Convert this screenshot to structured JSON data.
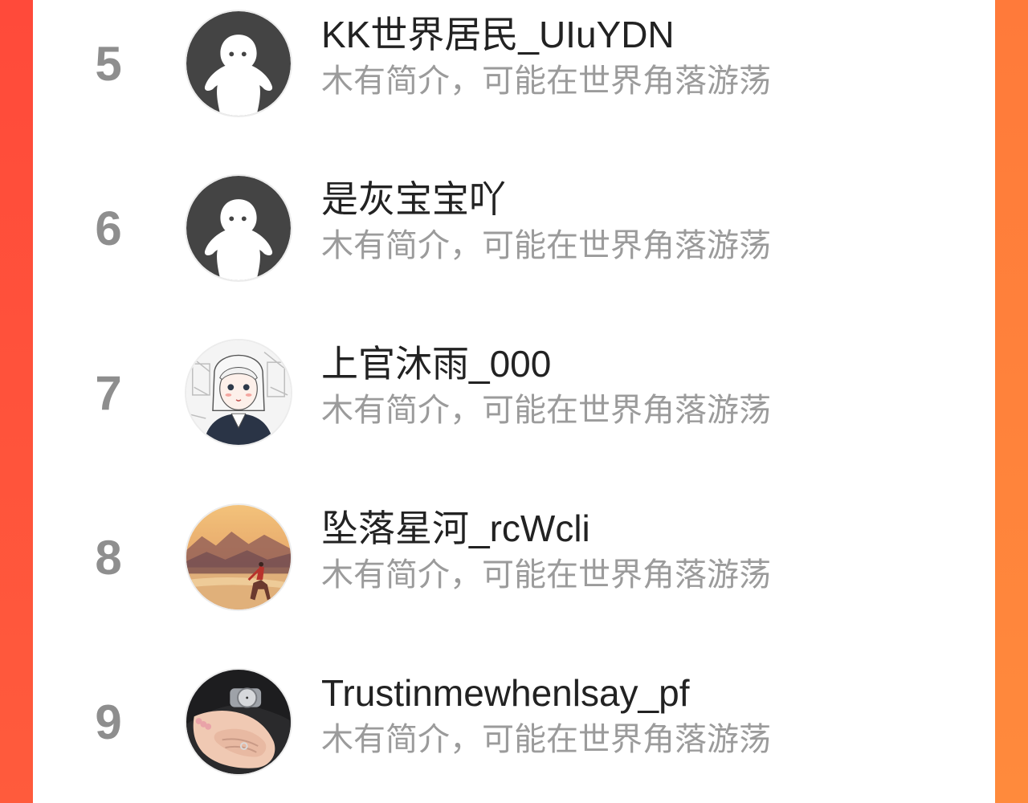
{
  "ranking": {
    "items": [
      {
        "rank": "5",
        "name": "KK世界居民_UIuYDN",
        "desc": "木有简介，可能在世界角落游荡",
        "avatar": "default-avatar-icon"
      },
      {
        "rank": "6",
        "name": "是灰宝宝吖",
        "desc": "木有简介，可能在世界角落游荡",
        "avatar": "default-avatar-icon"
      },
      {
        "rank": "7",
        "name": "上官沐雨_000",
        "desc": "木有简介，可能在世界角落游荡",
        "avatar": "anime-girl-avatar"
      },
      {
        "rank": "8",
        "name": "坠落星河_rcWcli",
        "desc": "木有简介，可能在世界角落游荡",
        "avatar": "landscape-avatar"
      },
      {
        "rank": "9",
        "name": "Trustinmewhenlsay_pf",
        "desc": "木有简介，可能在世界角落游荡",
        "avatar": "holding-hands-avatar"
      }
    ]
  },
  "colors": {
    "background_gradient_start": "#ff5a3c",
    "background_gradient_end": "#ff8a3a",
    "rank_color": "#8e8e8e",
    "name_color": "#222222",
    "desc_color": "#9b9b9b"
  }
}
